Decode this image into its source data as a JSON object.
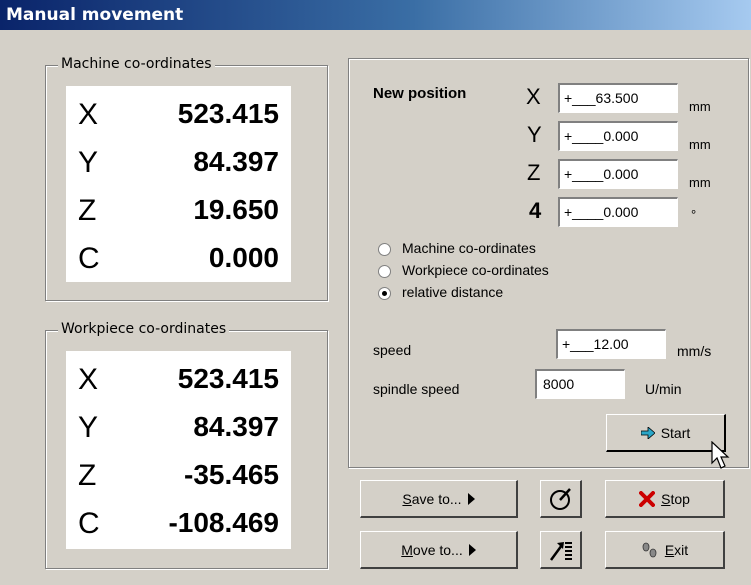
{
  "window": {
    "title": "Manual movement"
  },
  "machine": {
    "legend": "Machine co-ordinates",
    "rows": [
      {
        "axis": "X",
        "value": "523.415"
      },
      {
        "axis": "Y",
        "value": "84.397"
      },
      {
        "axis": "Z",
        "value": "19.650"
      },
      {
        "axis": "C",
        "value": "0.000"
      }
    ]
  },
  "workpiece": {
    "legend": "Workpiece co-ordinates",
    "rows": [
      {
        "axis": "X",
        "value": "523.415"
      },
      {
        "axis": "Y",
        "value": "84.397"
      },
      {
        "axis": "Z",
        "value": "-35.465"
      },
      {
        "axis": "C",
        "value": "-108.469"
      }
    ]
  },
  "new_position": {
    "label": "New position",
    "fields": [
      {
        "axis": "X",
        "value": "+___63.500",
        "unit": "mm"
      },
      {
        "axis": "Y",
        "value": "+____0.000",
        "unit": "mm"
      },
      {
        "axis": "Z",
        "value": "+____0.000",
        "unit": "mm"
      },
      {
        "axis": "4",
        "value": "+____0.000",
        "unit": "°"
      }
    ]
  },
  "mode": {
    "options": [
      "Machine co-ordinates",
      "Workpiece co-ordinates",
      "relative distance"
    ],
    "selected": "relative distance"
  },
  "speed": {
    "label": "speed",
    "value": "+___12.00",
    "unit": "mm/s"
  },
  "spindle": {
    "label": "spindle speed",
    "value": "8000",
    "unit": "U/min"
  },
  "buttons": {
    "start": "Start",
    "save_to_u": "S",
    "save_to_rest": "ave to...",
    "move_to_u": "M",
    "move_to_rest": "ove to...",
    "stop_u": "S",
    "stop_rest": "top",
    "exit_u": "E",
    "exit_rest": "xit"
  },
  "colors": {
    "title_bar": "#0a246a",
    "face": "#d4d0c8",
    "stop_icon": "#cc0000",
    "start_arrow": "#2aa6c8"
  }
}
